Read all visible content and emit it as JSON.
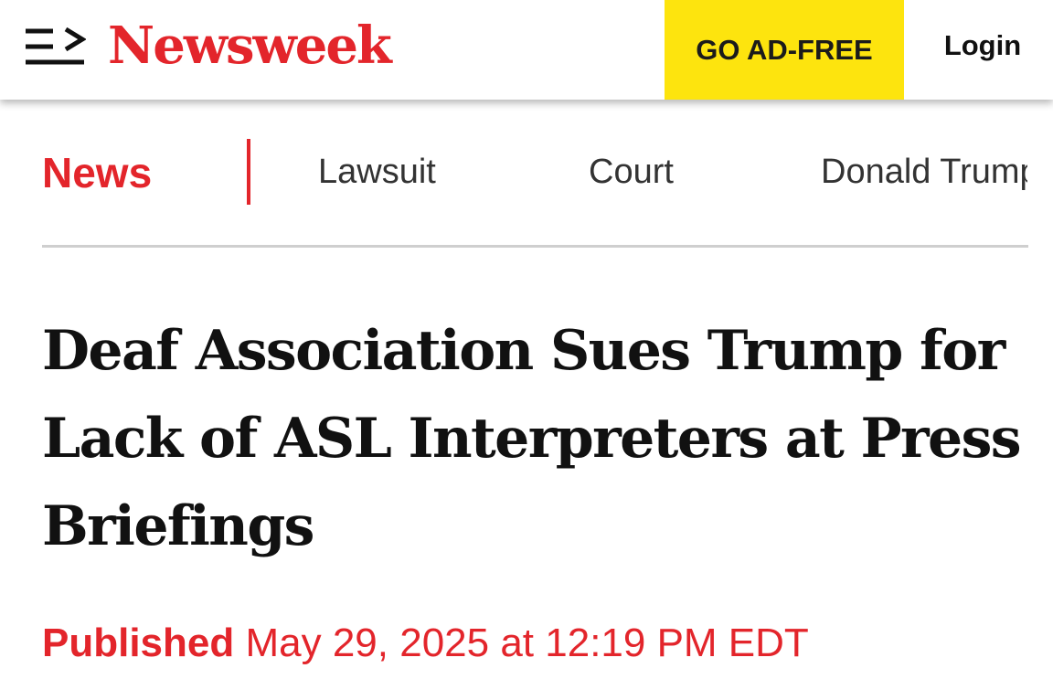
{
  "header": {
    "logo_text": "Newsweek",
    "ad_free_label": "GO AD-FREE",
    "login_label": "Login"
  },
  "subnav": {
    "section": "News",
    "tags": [
      "Lawsuit",
      "Court",
      "Donald Trump"
    ]
  },
  "article": {
    "headline": "Deaf Association Sues Trump for Lack of ASL Interpreters at Press Briefings",
    "published_label": "Published",
    "published_date": "May 29, 2025 at 12:19 PM EDT"
  },
  "colors": {
    "brand_red": "#e3252b",
    "ad_free_yellow": "#fde40e",
    "text_dark": "#111111"
  },
  "icons": {
    "menu": "menu-arrow-icon"
  }
}
